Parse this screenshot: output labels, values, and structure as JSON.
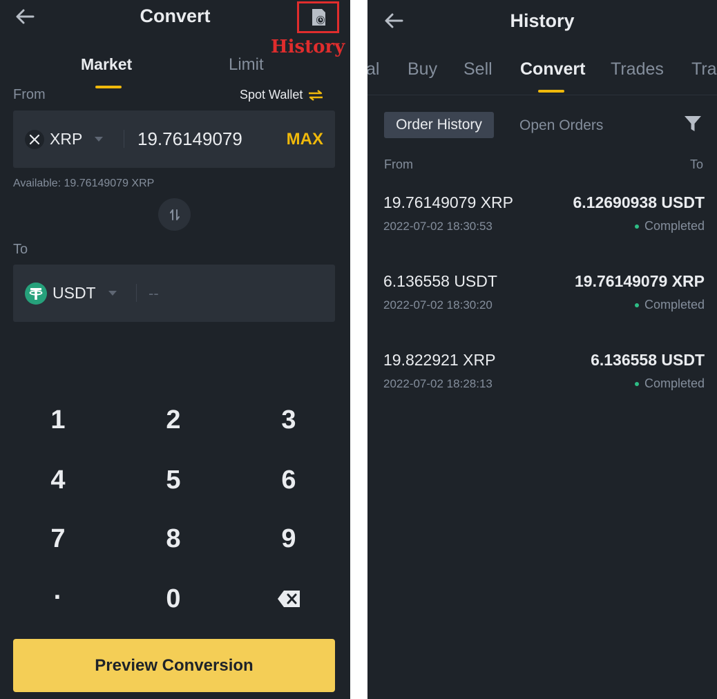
{
  "convert": {
    "title": "Convert",
    "history_annotation": "History",
    "tabs": {
      "market": "Market",
      "limit": "Limit"
    },
    "from_label": "From",
    "spot_wallet": "Spot Wallet",
    "from_coin": "XRP",
    "from_amount": "19.76149079",
    "max_label": "MAX",
    "available": "Available: 19.76149079 XRP",
    "to_label": "To",
    "to_coin": "USDT",
    "to_amount_placeholder": "--",
    "keypad": [
      "1",
      "2",
      "3",
      "4",
      "5",
      "6",
      "7",
      "8",
      "9",
      "·",
      "0"
    ],
    "preview_button": "Preview Conversion",
    "colors": {
      "accent": "#f0b90b",
      "button": "#f4ce56",
      "background": "#1e2329",
      "field": "#2b3139",
      "annotation": "#e02d2d"
    }
  },
  "history": {
    "title": "History",
    "tabs": [
      "al",
      "Buy",
      "Sell",
      "Convert",
      "Trades",
      "Tra"
    ],
    "active_tab": "Convert",
    "subtabs": {
      "order_history": "Order History",
      "open_orders": "Open Orders"
    },
    "columns": {
      "from": "From",
      "to": "To"
    },
    "orders": [
      {
        "from": "19.76149079 XRP",
        "to": "6.12690938 USDT",
        "time": "2022-07-02 18:30:53",
        "status": "Completed"
      },
      {
        "from": "6.136558 USDT",
        "to": "19.76149079 XRP",
        "time": "2022-07-02 18:30:20",
        "status": "Completed"
      },
      {
        "from": "19.822921 XRP",
        "to": "6.136558 USDT",
        "time": "2022-07-02 18:28:13",
        "status": "Completed"
      }
    ],
    "colors": {
      "completed_dot": "#2ebd85"
    }
  }
}
